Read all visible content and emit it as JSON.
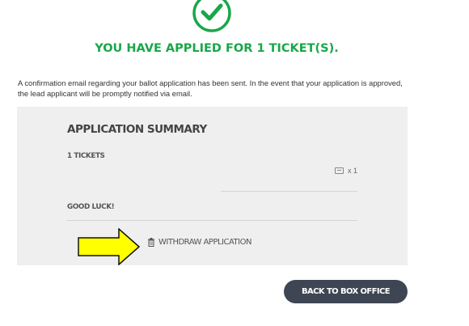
{
  "confirmation": {
    "headline": "YOU HAVE APPLIED FOR 1 TICKET(S).",
    "message": "A confirmation email regarding your ballot application has been sent. In the event that your application is approved, the lead applicant will be promptly notified via email.",
    "icon": "check-circle-icon",
    "accent_color": "#1aa64a"
  },
  "summary": {
    "title": "APPLICATION SUMMARY",
    "tickets_label": "1 TICKETS",
    "ticket_icon": "ticket-icon",
    "ticket_quantity": "x 1",
    "good_luck": "GOOD LUCK!",
    "withdraw_label": "WITHDRAW APPLICATION",
    "withdraw_icon": "trash-icon"
  },
  "annotation": {
    "icon": "arrow-right-icon",
    "color": "#ffff00"
  },
  "footer": {
    "back_button_label": "BACK TO BOX OFFICE",
    "button_color": "#3e4553"
  }
}
